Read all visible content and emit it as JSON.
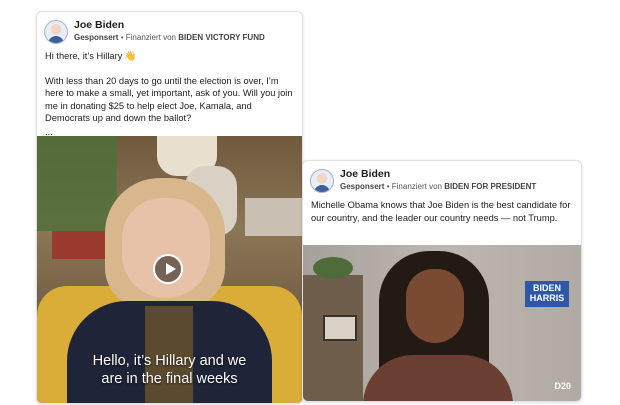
{
  "ads": [
    {
      "advertiser": "Joe Biden",
      "sponsored": "Gesponsert",
      "separator": "•",
      "funded_by_prefix": "Finanziert von",
      "funder": "BIDEN VICTORY FUND",
      "greeting": "Hi there, it’s Hillary 👋",
      "message": "With less than 20 days to go until the election is over, I’m here to make a small, yet important, ask of you. Will you join me in donating $25 to help elect Joe, Kamala, and Democrats up and down the ballot?",
      "ellipsis": "...",
      "caption_line1": "Hello, it’s Hillary and we",
      "caption_line2": "are in the final weeks"
    },
    {
      "advertiser": "Joe Biden",
      "sponsored": "Gesponsert",
      "separator": "•",
      "funded_by_prefix": "Finanziert von",
      "funder": "BIDEN FOR PRESIDENT",
      "message": "Michelle Obama knows that Joe Biden is the best candidate for our country, and the leader our country needs — not Trump.",
      "sign_text": "BIDEN HARRIS",
      "logo": "D20"
    }
  ]
}
